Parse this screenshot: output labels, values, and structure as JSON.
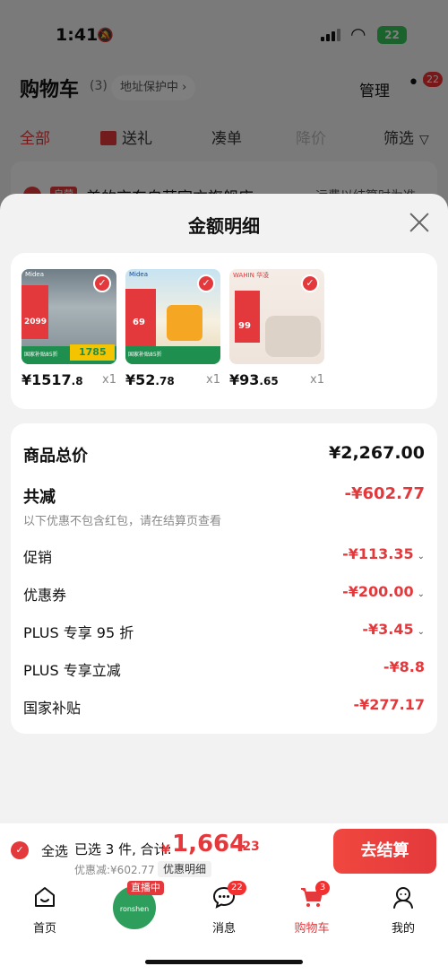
{
  "status_bar": {
    "time": "1:41",
    "battery": "22"
  },
  "header": {
    "title": "购物车",
    "count": "(3)",
    "address_pill": "地址保护中 ›",
    "manage": "管理",
    "more_badge": "22"
  },
  "filter_tabs": [
    {
      "label": "全部"
    },
    {
      "label": "送礼"
    },
    {
      "label": "凑单"
    },
    {
      "label": "降价"
    },
    {
      "label": "筛选"
    }
  ],
  "store": {
    "tag": "自营",
    "name": "美的京东自营官方旗舰店 ›",
    "shipping": "运费以结算时为准"
  },
  "sheet": {
    "title": "金额明细",
    "products": [
      {
        "price_int": "¥1517",
        "price_dec": ".8",
        "qty": "x1",
        "img_texts": [
          "Midea",
          "国家补贴85折",
          "1785",
          "2099"
        ]
      },
      {
        "price_int": "¥52",
        "price_dec": ".78",
        "qty": "x1",
        "img_texts": [
          "Midea",
          "国家补贴85折",
          "58.7",
          "69"
        ]
      },
      {
        "price_int": "¥93",
        "price_dec": ".65",
        "qty": "x1",
        "img_texts": [
          "WAHIN 华凌",
          "99"
        ]
      }
    ],
    "details": {
      "total_label": "商品总价",
      "total_value": "¥2,267.00",
      "reduce_label": "共减",
      "reduce_value": "-¥602.77",
      "reduce_note": "以下优惠不包含红包，请在结算页查看",
      "items": [
        {
          "label": "促销",
          "value": "-¥113.35",
          "chevron": true
        },
        {
          "label": "优惠券",
          "value": "-¥200.00",
          "chevron": true
        },
        {
          "label": "PLUS 专享 95 折",
          "value": "-¥3.45",
          "chevron": true
        },
        {
          "label": "PLUS 专享立减",
          "value": "-¥8.8",
          "chevron": false
        },
        {
          "label": "国家补贴",
          "value": "-¥277.17",
          "chevron": false
        }
      ]
    }
  },
  "bottom_bar": {
    "select_all": "全选",
    "summary": "已选 3 件, 合计:",
    "total_currency": "¥",
    "total_int": "1,664",
    "total_dec": ".23",
    "discount_line": "优惠减:¥602.77",
    "detail_chip": "优惠明细",
    "checkout": "去结算"
  },
  "tab_bar": [
    {
      "label": "首页",
      "icon": "home-icon"
    },
    {
      "label": "ronshen",
      "icon": "live-avatar",
      "live_tag": "直播中"
    },
    {
      "label": "消息",
      "icon": "message-icon",
      "badge": "22"
    },
    {
      "label": "购物车",
      "icon": "cart-icon",
      "badge": "3",
      "active": true
    },
    {
      "label": "我的",
      "icon": "profile-icon"
    }
  ],
  "colors": {
    "accent": "#e4393c",
    "green": "#1e8f4e"
  }
}
